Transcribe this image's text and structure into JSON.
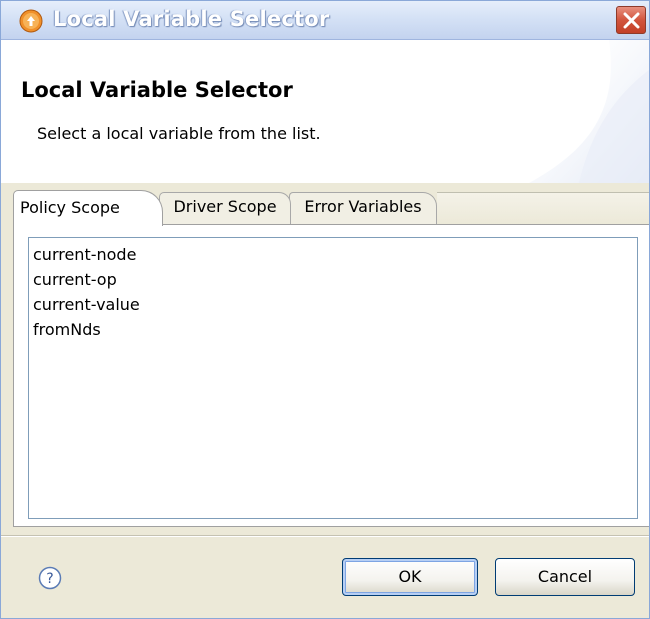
{
  "window": {
    "title": "Local Variable Selector",
    "icon": "orange-circle-arrow-icon",
    "close_icon": "close-icon"
  },
  "header": {
    "title": "Local Variable Selector",
    "description": "Select a local variable from the list."
  },
  "tabs": [
    {
      "label": "Policy Scope",
      "selected": true
    },
    {
      "label": "Driver Scope",
      "selected": false
    },
    {
      "label": "Error Variables",
      "selected": false
    }
  ],
  "variables": [
    "current-node",
    "current-op",
    "current-value",
    "fromNds"
  ],
  "footer": {
    "help_icon": "help-icon",
    "ok_label": "OK",
    "cancel_label": "Cancel"
  },
  "colors": {
    "title_bar": "#c3d3ef",
    "close_button": "#d2553e",
    "dialog_background": "#ece9d8",
    "default_button_border": "#003c74"
  }
}
